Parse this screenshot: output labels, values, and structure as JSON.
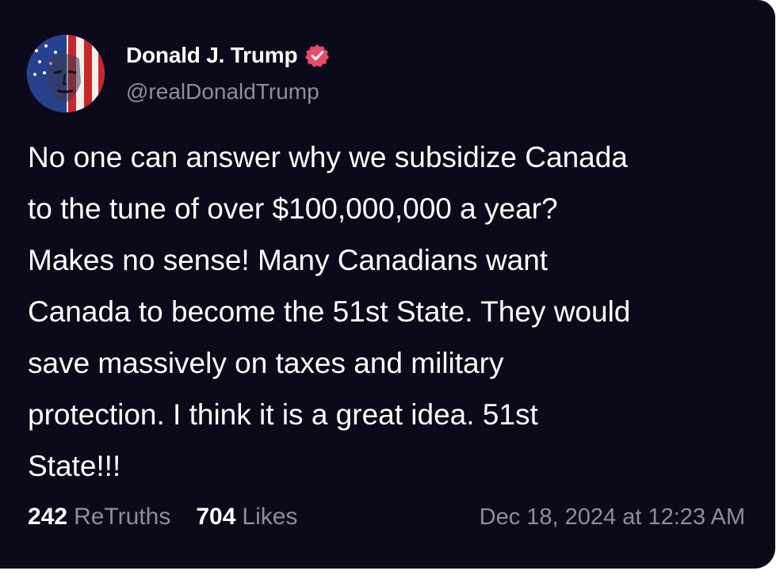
{
  "post": {
    "author": {
      "display_name": "Donald J. Trump",
      "handle": "@realDonaldTrump",
      "verified": true,
      "avatar_icon": "flag-portrait-avatar"
    },
    "text": "No one can answer why we subsidize Canada\nto the tune of over $100,000,000 a year?\nMakes no sense! Many Canadians want\nCanada to become the 51st State. They would\nsave massively on taxes and military\nprotection. I think it is a great idea. 51st\nState!!!",
    "stats": {
      "retruths_count": "242",
      "retruths_label": "ReTruths",
      "likes_count": "704",
      "likes_label": "Likes"
    },
    "timestamp": "Dec 18, 2024 at 12:23 AM"
  },
  "colors": {
    "background": "#0b0a1a",
    "text_primary": "#ffffff",
    "text_secondary": "#8e8d9b",
    "verified_badge": "#ea4a6c"
  }
}
